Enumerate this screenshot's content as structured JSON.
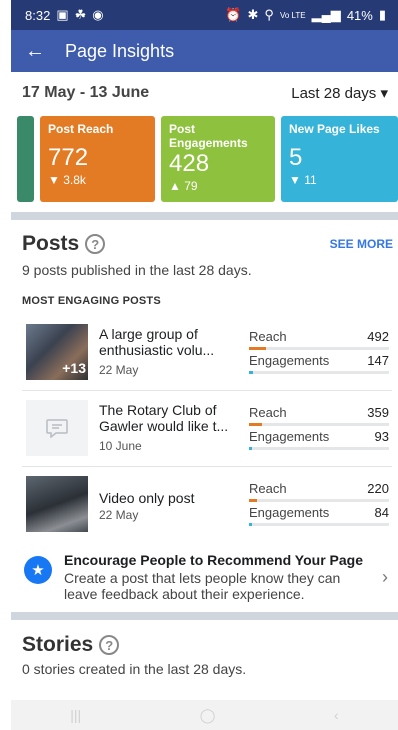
{
  "status_bar": {
    "time": "8:32",
    "battery": "41%",
    "network": "Vo LTE"
  },
  "app_bar": {
    "title": "Page Insights"
  },
  "date_range": {
    "range": "17 May - 13 June",
    "period": "Last 28 days"
  },
  "metric_cards": [
    {
      "label": "Post Reach",
      "value": "772",
      "delta": "3.8k",
      "direction": "down",
      "color": "#e37b24"
    },
    {
      "label": "Post Engagements",
      "value": "428",
      "delta": "79",
      "direction": "up",
      "color": "#8ec13e"
    },
    {
      "label": "New Page Likes",
      "value": "5",
      "delta": "11",
      "direction": "down",
      "color": "#35b3d8"
    }
  ],
  "posts_section": {
    "title": "Posts",
    "see_more": "SEE MORE",
    "subtitle": "9 posts published in the last 28 days.",
    "section_label": "MOST ENGAGING POSTS",
    "reach_label": "Reach",
    "engagements_label": "Engagements",
    "posts": [
      {
        "title": "A large group of enthusiastic volu...",
        "date": "22 May",
        "reach": "492",
        "engagements": "147",
        "thumb_badge": "+13",
        "reach_fraction": 0.12,
        "engagement_fraction": 0.03
      },
      {
        "title": "The Rotary Club of Gawler would like t...",
        "date": "10 June",
        "reach": "359",
        "engagements": "93",
        "reach_fraction": 0.09,
        "engagement_fraction": 0.02
      },
      {
        "title": "Video only post",
        "date": "22 May",
        "reach": "220",
        "engagements": "84",
        "reach_fraction": 0.06,
        "engagement_fraction": 0.02
      }
    ]
  },
  "encourage": {
    "title": "Encourage People to Recommend Your Page",
    "description": "Create a post that lets people know they can leave feedback about their experience."
  },
  "stories_section": {
    "title": "Stories",
    "subtitle": "0 stories created in the last 28 days."
  },
  "colors": {
    "reach_bar": "#e37b24",
    "engagement_bar": "#35b3d8",
    "app_bar": "#3f5bab",
    "status_bar": "#263a75"
  }
}
